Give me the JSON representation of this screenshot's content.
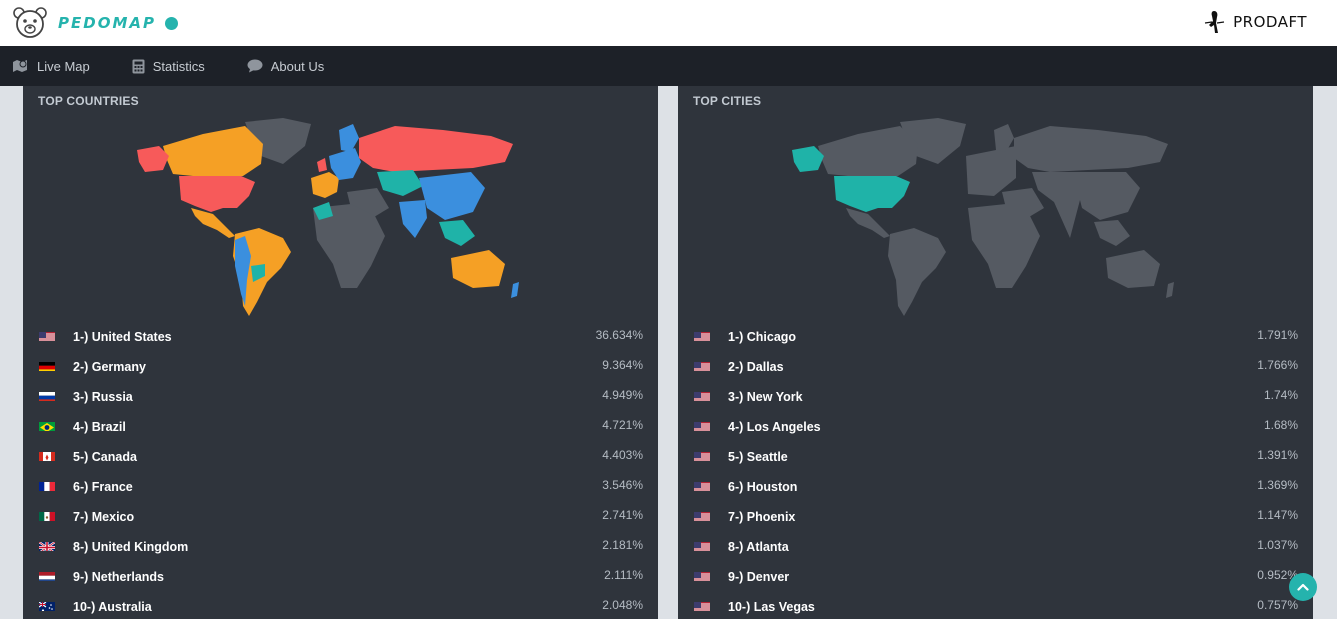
{
  "header": {
    "brand": "PEDOMAP",
    "partner": "PRODAFT"
  },
  "nav": [
    {
      "label": "Live Map",
      "icon": "map-icon"
    },
    {
      "label": "Statistics",
      "icon": "calculator-icon"
    },
    {
      "label": "About Us",
      "icon": "chat-bubble-icon"
    }
  ],
  "colors": {
    "accent": "#25b3ad",
    "red": "#f75a5a",
    "orange": "#f5a025",
    "blue": "#3b8fde",
    "teal": "#1fb3a8",
    "land": "#555a62"
  },
  "countries": {
    "title": "TOP COUNTRIES",
    "items": [
      {
        "label": "1-) United States",
        "value": "36.634%",
        "flag": "us"
      },
      {
        "label": "2-) Germany",
        "value": "9.364%",
        "flag": "de"
      },
      {
        "label": "3-) Russia",
        "value": "4.949%",
        "flag": "ru"
      },
      {
        "label": "4-) Brazil",
        "value": "4.721%",
        "flag": "br"
      },
      {
        "label": "5-) Canada",
        "value": "4.403%",
        "flag": "ca"
      },
      {
        "label": "6-) France",
        "value": "3.546%",
        "flag": "fr"
      },
      {
        "label": "7-) Mexico",
        "value": "2.741%",
        "flag": "mx"
      },
      {
        "label": "8-) United Kingdom",
        "value": "2.181%",
        "flag": "gb"
      },
      {
        "label": "9-) Netherlands",
        "value": "2.111%",
        "flag": "nl"
      },
      {
        "label": "10-) Australia",
        "value": "2.048%",
        "flag": "au"
      }
    ]
  },
  "cities": {
    "title": "TOP CITIES",
    "items": [
      {
        "label": "1-) Chicago",
        "value": "1.791%",
        "flag": "us"
      },
      {
        "label": "2-) Dallas",
        "value": "1.766%",
        "flag": "us"
      },
      {
        "label": "3-) New York",
        "value": "1.74%",
        "flag": "us"
      },
      {
        "label": "4-) Los Angeles",
        "value": "1.68%",
        "flag": "us"
      },
      {
        "label": "5-) Seattle",
        "value": "1.391%",
        "flag": "us"
      },
      {
        "label": "6-) Houston",
        "value": "1.369%",
        "flag": "us"
      },
      {
        "label": "7-) Phoenix",
        "value": "1.147%",
        "flag": "us"
      },
      {
        "label": "8-) Atlanta",
        "value": "1.037%",
        "flag": "us"
      },
      {
        "label": "9-) Denver",
        "value": "0.952%",
        "flag": "us"
      },
      {
        "label": "10-) Las Vegas",
        "value": "0.757%",
        "flag": "us"
      }
    ]
  }
}
